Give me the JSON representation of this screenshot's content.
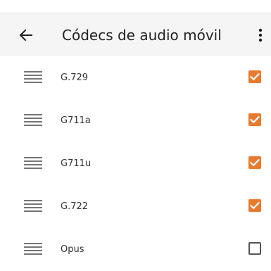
{
  "app_bar": {
    "title": "Códecs de audio móvil",
    "back_icon": "arrow-left-icon",
    "menu_icon": "more-vertical-icon"
  },
  "codecs": [
    {
      "label": "G.729",
      "checked": true
    },
    {
      "label": "G711a",
      "checked": true
    },
    {
      "label": "G711u",
      "checked": true
    },
    {
      "label": "G.722",
      "checked": true
    },
    {
      "label": "Opus",
      "checked": false
    }
  ],
  "colors": {
    "accent": "#e87a2e",
    "app_bar_bg": "#f5f5f5",
    "handle": "#757575"
  }
}
